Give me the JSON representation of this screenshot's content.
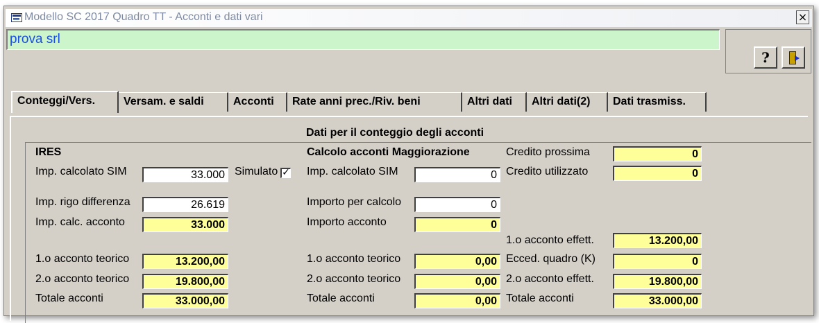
{
  "window": {
    "title": "Modello SC 2017 Quadro TT - Acconti e dati vari",
    "close_glyph": "×"
  },
  "company": {
    "name": "prova srl"
  },
  "toolbar": {
    "help_glyph": "?"
  },
  "tabs": [
    {
      "label": "Conteggi/Vers."
    },
    {
      "label": "Versam. e saldi"
    },
    {
      "label": "Acconti"
    },
    {
      "label": "Rate anni prec./Riv. beni"
    },
    {
      "label": "Altri dati"
    },
    {
      "label": "Altri dati(2)"
    },
    {
      "label": "Dati trasmiss."
    }
  ],
  "panel": {
    "title": "Dati per il conteggio degli acconti"
  },
  "ires": {
    "header": "IRES",
    "imp_calc_sim": {
      "label": "Imp. calcolato SIM",
      "value": "33.000"
    },
    "simulato": {
      "label": "Simulato",
      "checked": true,
      "check_glyph": "✓"
    },
    "imp_rigo_diff": {
      "label": "Imp. rigo differenza",
      "value": "26.619"
    },
    "imp_calc_acconto": {
      "label": "Imp. calc. acconto",
      "value": "33.000"
    },
    "primo_acconto": {
      "label": "1.o acconto teorico",
      "value": "13.200,00"
    },
    "secondo_acconto": {
      "label": "2.o acconto teorico",
      "value": "19.800,00"
    },
    "totale": {
      "label": "Totale acconti",
      "value": "33.000,00"
    }
  },
  "maggiorazione": {
    "header": "Calcolo acconti Maggiorazione",
    "imp_calc_sim": {
      "label": "Imp. calcolato SIM",
      "value": "0"
    },
    "importo_calcolo": {
      "label": "Importo per calcolo",
      "value": "0"
    },
    "importo_acconto": {
      "label": "Importo acconto",
      "value": "0"
    },
    "primo_acconto": {
      "label": "1.o acconto teorico",
      "value": "0,00"
    },
    "secondo_acconto": {
      "label": "2.o acconto teorico",
      "value": "0,00"
    },
    "totale": {
      "label": "Totale acconti",
      "value": "0,00"
    }
  },
  "right": {
    "credito_prossima": {
      "label": "Credito prossima",
      "value": "0"
    },
    "credito_utilizzato": {
      "label": "Credito utilizzato",
      "value": "0"
    },
    "primo_effett": {
      "label": "1.o acconto effett.",
      "value": "13.200,00"
    },
    "ecced_quadro": {
      "label": "Ecced. quadro (K)",
      "value": "0"
    },
    "secondo_effett": {
      "label": "2.o acconto effett.",
      "value": "19.800,00"
    },
    "totale": {
      "label": "Totale acconti",
      "value": "33.000,00"
    }
  }
}
